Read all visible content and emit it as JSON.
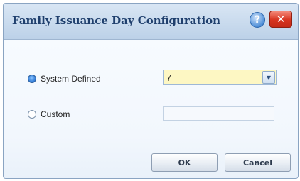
{
  "window": {
    "title": "Family Issuance Day Configuration",
    "help_icon": "help-icon",
    "help_glyph": "?",
    "close_icon": "close-icon",
    "close_glyph": "✕"
  },
  "options": {
    "system_defined": {
      "label": "System Defined",
      "selected": true
    },
    "custom": {
      "label": "Custom",
      "selected": false
    }
  },
  "issuance_day_select": {
    "value": "7",
    "arrow_glyph": "▼"
  },
  "custom_day_input": {
    "value": "",
    "placeholder": ""
  },
  "buttons": {
    "ok": "OK",
    "cancel": "Cancel"
  },
  "colors": {
    "title_text": "#1f3f6d",
    "combo_background": "#fdf7c3",
    "close_button": "#d7331f",
    "help_button": "#4f8fd8"
  }
}
